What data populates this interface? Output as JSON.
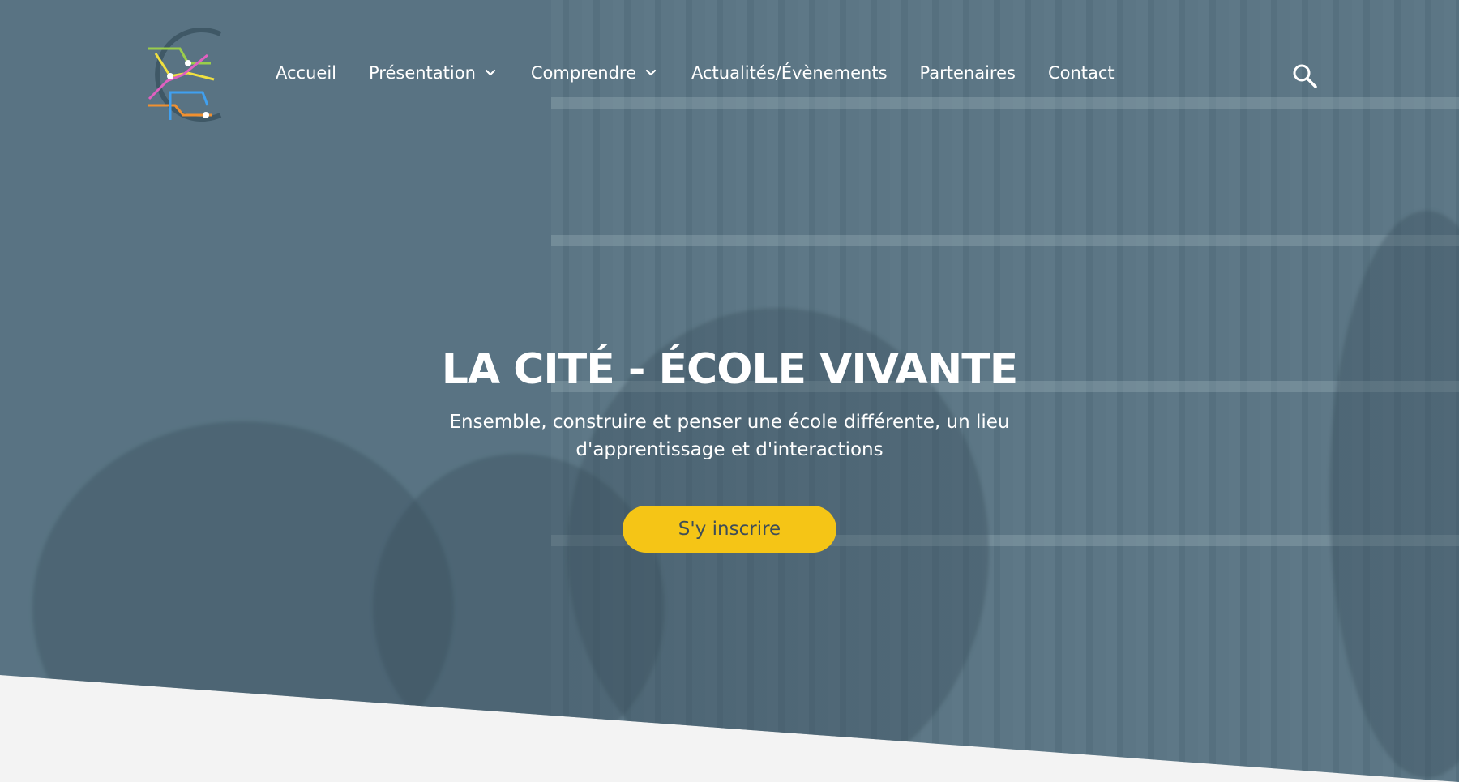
{
  "nav": {
    "items": [
      {
        "label": "Accueil",
        "has_dropdown": false
      },
      {
        "label": "Présentation",
        "has_dropdown": true
      },
      {
        "label": "Comprendre",
        "has_dropdown": true
      },
      {
        "label": "Actualités/Évènements",
        "has_dropdown": false
      },
      {
        "label": "Partenaires",
        "has_dropdown": false
      },
      {
        "label": "Contact",
        "has_dropdown": false
      }
    ],
    "search_icon": "search-icon",
    "logo_icon": "school-logo"
  },
  "hero": {
    "title": "LA CITÉ - ÉCOLE VIVANTE",
    "subtitle": "Ensemble, construire et penser une école différente, un lieu d'apprentissage et d'interactions",
    "cta_label": "S'y inscrire"
  },
  "colors": {
    "overlay": "#5c7684",
    "cta": "#f5c516",
    "cta_text": "#3e4d57",
    "page_bg": "#f3f3f3"
  }
}
